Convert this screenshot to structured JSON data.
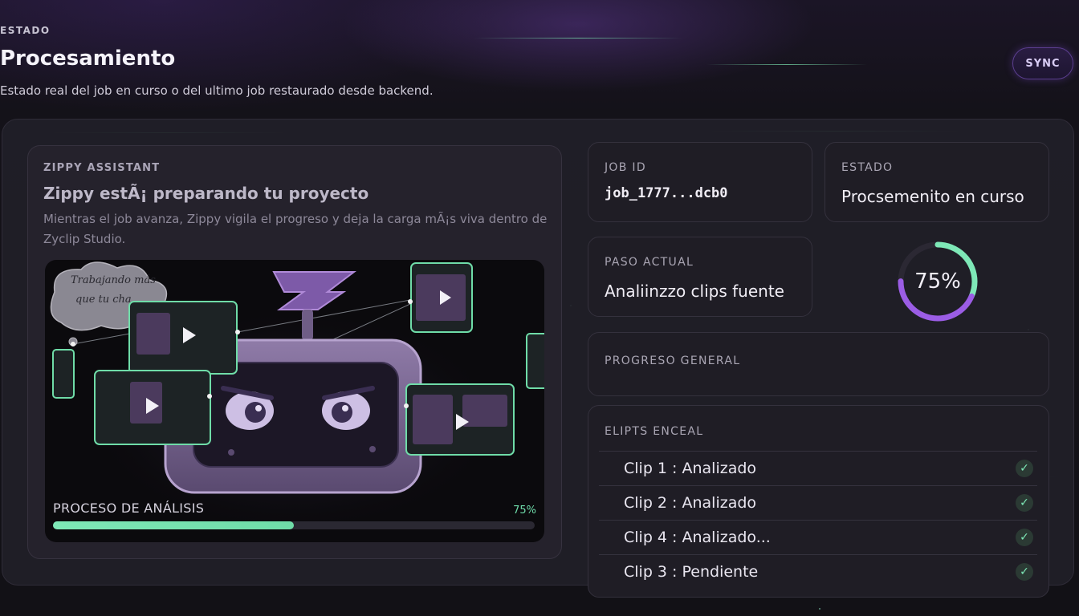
{
  "header": {
    "eyebrow": "ESTADO",
    "title": "Procesamiento",
    "subtitle": "Estado real del job en curso o del ultimo job restaurado desde backend.",
    "sync_label": "SYNC"
  },
  "assistant": {
    "label": "ZIPPY ASSISTANT",
    "title": "Zippy estÃ¡ preparando tu proyecto",
    "description": "Mientras el job avanza, Zippy vigila el progreso y deja la carga mÃ¡s viva dentro de Zyclip Studio.",
    "bubble_line1": "Trabajando más",
    "bubble_line2": "que tu cha",
    "analysis_label": "PROCESO DE ANÁLISIS",
    "analysis_pct_text": "75%",
    "analysis_progress": 0.5
  },
  "job": {
    "id_label": "JOB ID",
    "id_value": "job_1777...dcb0",
    "status_label": "ESTADO",
    "status_value": "Procsemenito en curso",
    "step_label": "PASO ACTUAL",
    "step_value": "Analiinzzo clips fuente",
    "percent_text": "75%",
    "percent": 75,
    "overall_label": "PROGRESO GENERAL"
  },
  "clips": {
    "label": "ELIPTS ENCEAL",
    "items": [
      {
        "label": "Clip 1 : Analizado",
        "status": "check-icon"
      },
      {
        "label": "Clip 2 : Analizado",
        "status": "check-icon"
      },
      {
        "label": "Clip 4 : Analizado...",
        "status": "check-icon"
      },
      {
        "label": "Clip 3 : Pendiente",
        "status": "check-icon"
      }
    ]
  },
  "colors": {
    "accent_green": "#7ee8b7",
    "accent_purple": "#9b5de5",
    "panel": "#1f1d25"
  }
}
